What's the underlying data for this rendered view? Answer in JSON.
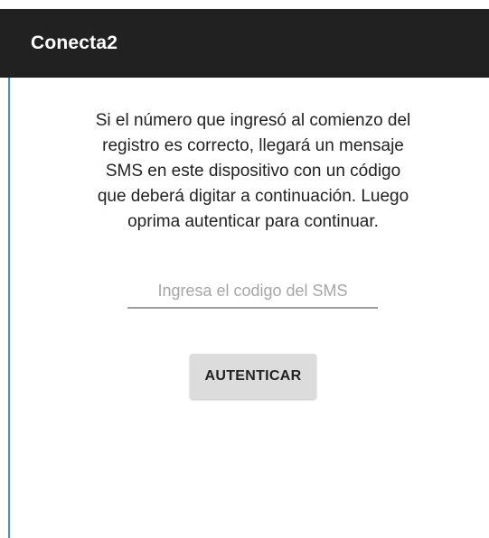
{
  "app_bar": {
    "title": "Conecta2"
  },
  "main": {
    "message_lines": [
      "Si el número que ingresó al comienzo del",
      "registro es correcto, llegará un mensaje",
      "SMS en este dispositivo con un código",
      "que deberá digitar a continuación. Luego",
      "oprima autenticar para continuar."
    ],
    "sms_input": {
      "value": "",
      "placeholder": "Ingresa el codigo del SMS"
    },
    "auth_button_label": "AUTENTICAR"
  },
  "colors": {
    "app_bar_bg": "#212121",
    "app_bar_text": "#ffffff",
    "accent_edge": "#3d8fd8",
    "button_bg": "#dcdcdc"
  }
}
